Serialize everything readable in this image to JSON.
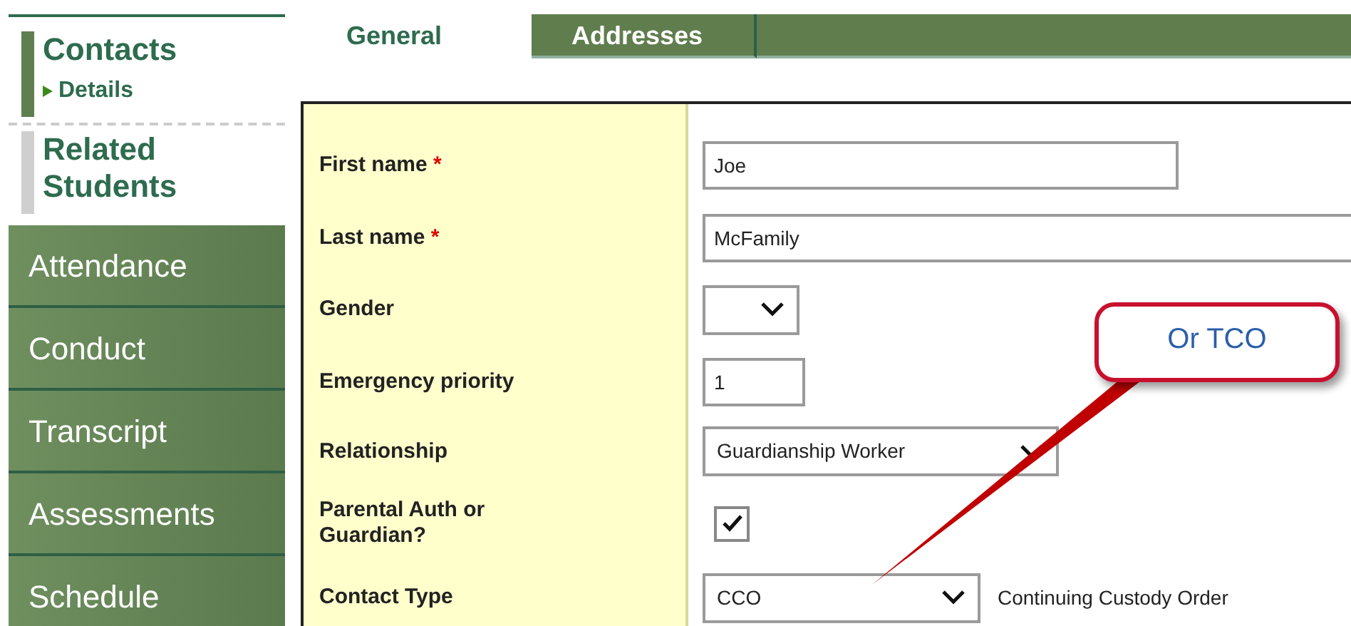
{
  "sidebar": {
    "sections": [
      {
        "label": "Contacts",
        "selected": true,
        "children": [
          {
            "label": "Details",
            "selected": true
          }
        ]
      },
      {
        "label": "Related Students",
        "selected": false
      }
    ],
    "nav": [
      "Attendance",
      "Conduct",
      "Transcript",
      "Assessments",
      "Schedule"
    ]
  },
  "tabs": [
    {
      "label": "General",
      "selected": true
    },
    {
      "label": "Addresses",
      "selected": false
    }
  ],
  "form": {
    "rows": [
      {
        "label": "First name",
        "required_mark": "*",
        "kind": "text",
        "value": "Joe"
      },
      {
        "label": "Last name",
        "required_mark": "*",
        "kind": "text",
        "value": "McFamily"
      },
      {
        "label": "Gender",
        "kind": "select"
      },
      {
        "label": "Emergency priority",
        "kind": "text",
        "value": "1"
      },
      {
        "label": "Relationship",
        "kind": "select",
        "value": "Guardianship Worker"
      },
      {
        "label": "Parental Auth or Guardian?",
        "kind": "checkbox",
        "checked": true
      },
      {
        "label": "Contact Type",
        "kind": "select",
        "value": "CCO",
        "description": "Continuing Custody Order"
      }
    ]
  },
  "callout": {
    "text": "Or TCO"
  }
}
